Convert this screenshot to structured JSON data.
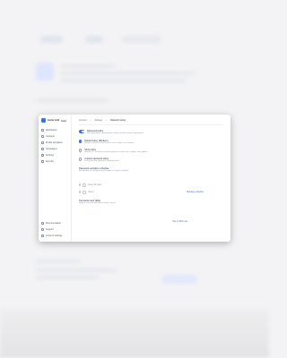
{
  "app": {
    "name": "Acme Link",
    "badge": "Beta"
  },
  "sidebar": {
    "items": [
      {
        "label": "Dashboard"
      },
      {
        "label": "Contacts"
      },
      {
        "label": "Profile templates"
      },
      {
        "label": "Campaigns"
      },
      {
        "label": "Settings"
      },
      {
        "label": "Security"
      }
    ],
    "footer": [
      {
        "label": "Documentation"
      },
      {
        "label": "Support"
      },
      {
        "label": "Account settings"
      }
    ]
  },
  "breadcrumb": {
    "items": [
      "Account",
      "Settings"
    ],
    "current": "Password policy"
  },
  "settings": {
    "main_toggle": {
      "label": "Password policy",
      "desc": "Set requirements for passwords used by members of your organization."
    },
    "options": [
      {
        "label": "Default policy (Medium)",
        "desc": "Require at least 8 characters with a mix of letters and numbers."
      },
      {
        "label": "Strict policy",
        "desc": "Require 12+ characters including uppercase, lowercase, numbers and symbols."
      },
      {
        "label": "Custom password policy",
        "desc": "Define your own password complexity rules."
      }
    ],
    "section": {
      "title": "Password expiration schedule",
      "desc": "Ask members to change their password on a regular schedule.",
      "link": "Manage schedule"
    },
    "list": [
      "Every 90 days",
      "Never"
    ],
    "mfa": {
      "title": "Two-factor auth (2FA)",
      "desc": "Require a second step when members sign in.",
      "link": "Set up 2FA now"
    }
  }
}
